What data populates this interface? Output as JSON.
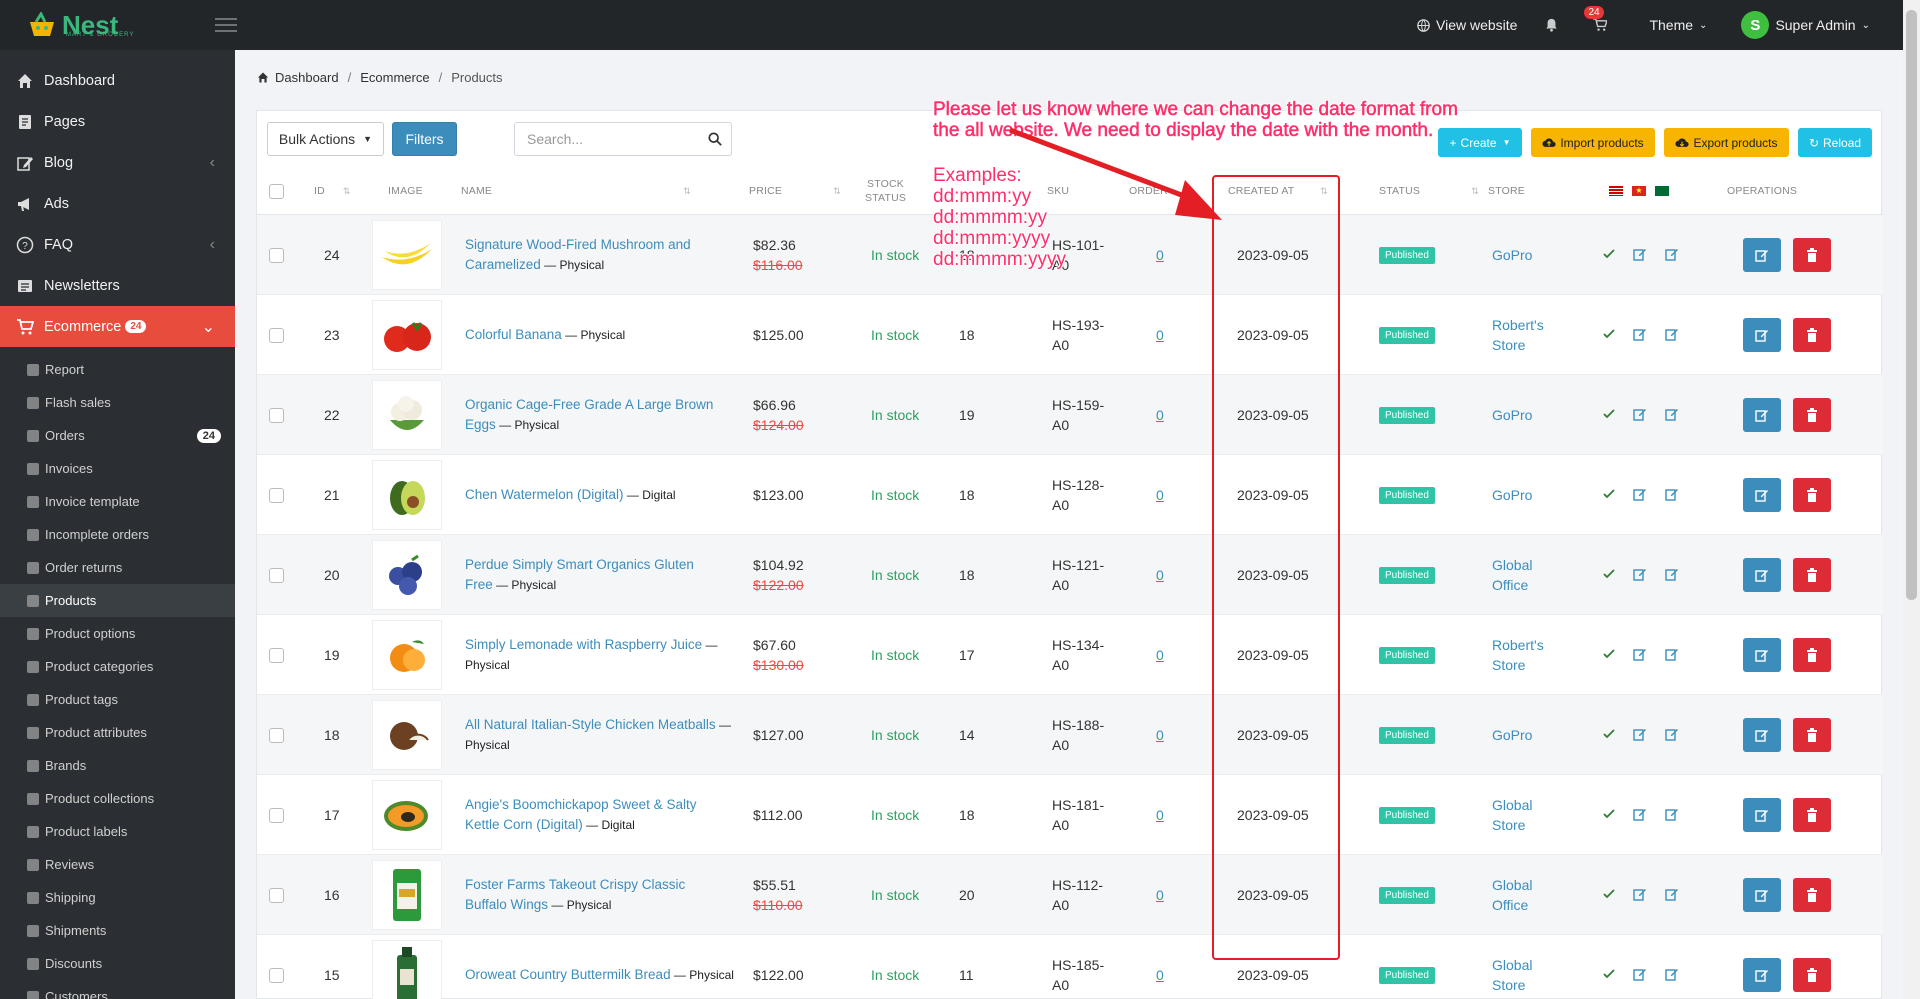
{
  "topbar": {
    "brand": "Nest",
    "brand_sub": "MART & GROCERY",
    "view_website": "View website",
    "notif_count": "24",
    "theme": "Theme",
    "avatar_letter": "S",
    "user": "Super Admin"
  },
  "sidebar": {
    "main": [
      {
        "label": "Dashboard"
      },
      {
        "label": "Pages"
      },
      {
        "label": "Blog"
      },
      {
        "label": "Ads"
      },
      {
        "label": "FAQ"
      },
      {
        "label": "Newsletters"
      }
    ],
    "ecommerce": {
      "label": "Ecommerce",
      "count": "24"
    },
    "sub": [
      {
        "label": "Report"
      },
      {
        "label": "Flash sales"
      },
      {
        "label": "Orders",
        "badge": "24"
      },
      {
        "label": "Invoices"
      },
      {
        "label": "Invoice template"
      },
      {
        "label": "Incomplete orders"
      },
      {
        "label": "Order returns"
      },
      {
        "label": "Products"
      },
      {
        "label": "Product options"
      },
      {
        "label": "Product categories"
      },
      {
        "label": "Product tags"
      },
      {
        "label": "Product attributes"
      },
      {
        "label": "Brands"
      },
      {
        "label": "Product collections"
      },
      {
        "label": "Product labels"
      },
      {
        "label": "Reviews"
      },
      {
        "label": "Shipping"
      },
      {
        "label": "Shipments"
      },
      {
        "label": "Discounts"
      },
      {
        "label": "Customers"
      }
    ]
  },
  "breadcrumb": [
    "Dashboard",
    "Ecommerce",
    "Products"
  ],
  "toolbar": {
    "bulk": "Bulk Actions",
    "filters": "Filters",
    "search_placeholder": "Search...",
    "create": "Create",
    "import": "Import products",
    "export": "Export products",
    "reload": "Reload"
  },
  "columns": {
    "id": "ID",
    "image": "IMAGE",
    "name": "NAME",
    "price": "PRICE",
    "stock_1": "STOCK",
    "stock_2": "STATUS",
    "sku": "SKU",
    "order": "ORDER",
    "created": "CREATED AT",
    "status": "STATUS",
    "store": "STORE",
    "operations": "OPERATIONS"
  },
  "rows": [
    {
      "id": "24",
      "name1": "Signature Wood-Fired Mushroom and",
      "name2": "Caramelized",
      "type": " — Physical",
      "price": "$82.36",
      "old": "$116.00",
      "stock": "In stock",
      "qty": "18",
      "sku1": "HS-101-",
      "sku2": "A0",
      "order": "0",
      "created": "2023-09-05",
      "status": "Published",
      "store1": "GoPro",
      "store2": "",
      "img": "banana"
    },
    {
      "id": "23",
      "name1": "Colorful Banana",
      "name2": "",
      "type": " — Physical",
      "price": "$125.00",
      "old": "",
      "stock": "In stock",
      "qty": "18",
      "sku1": "HS-193-",
      "sku2": "A0",
      "order": "0",
      "created": "2023-09-05",
      "status": "Published",
      "store1": "Robert's",
      "store2": "Store",
      "img": "tomato"
    },
    {
      "id": "22",
      "name1": "Organic Cage-Free Grade A Large Brown",
      "name2": "Eggs",
      "type": " — Physical",
      "price": "$66.96",
      "old": "$124.00",
      "stock": "In stock",
      "qty": "19",
      "sku1": "HS-159-",
      "sku2": "A0",
      "order": "0",
      "created": "2023-09-05",
      "status": "Published",
      "store1": "GoPro",
      "store2": "",
      "img": "cauliflower"
    },
    {
      "id": "21",
      "name1": "Chen Watermelon (Digital)",
      "name2": "",
      "type": " — Digital",
      "price": "$123.00",
      "old": "",
      "stock": "In stock",
      "qty": "18",
      "sku1": "HS-128-",
      "sku2": "A0",
      "order": "0",
      "created": "2023-09-05",
      "status": "Published",
      "store1": "GoPro",
      "store2": "",
      "img": "avocado"
    },
    {
      "id": "20",
      "name1": "Perdue Simply Smart Organics Gluten",
      "name2": "Free",
      "type": " — Physical",
      "price": "$104.92",
      "old": "$122.00",
      "stock": "In stock",
      "qty": "18",
      "sku1": "HS-121-",
      "sku2": "A0",
      "order": "0",
      "created": "2023-09-05",
      "status": "Published",
      "store1": "Global",
      "store2": "Office",
      "img": "blueberry"
    },
    {
      "id": "19",
      "name1": "Simply Lemonade with Raspberry Juice",
      "name2": "",
      "type": " — Physical",
      "price": "$67.60",
      "old": "$130.00",
      "stock": "In stock",
      "qty": "17",
      "sku1": "HS-134-",
      "sku2": "A0",
      "order": "0",
      "created": "2023-09-05",
      "status": "Published",
      "store1": "Robert's",
      "store2": "Store",
      "img": "orange"
    },
    {
      "id": "18",
      "name1": "All Natural Italian-Style Chicken Meatballs",
      "name2": "",
      "type": " — Physical",
      "price": "$127.00",
      "old": "",
      "stock": "In stock",
      "qty": "14",
      "sku1": "HS-188-",
      "sku2": "A0",
      "order": "0",
      "created": "2023-09-05",
      "status": "Published",
      "store1": "GoPro",
      "store2": "",
      "img": "coconut"
    },
    {
      "id": "17",
      "name1": "Angie's Boomchickapop Sweet & Salty",
      "name2": "Kettle Corn (Digital)",
      "type": " — Digital",
      "price": "$112.00",
      "old": "",
      "stock": "In stock",
      "qty": "18",
      "sku1": "HS-181-",
      "sku2": "A0",
      "order": "0",
      "created": "2023-09-05",
      "status": "Published",
      "store1": "Global",
      "store2": "Store",
      "img": "papaya"
    },
    {
      "id": "16",
      "name1": "Foster Farms Takeout Crispy Classic",
      "name2": "Buffalo Wings",
      "type": " — Physical",
      "price": "$55.51",
      "old": "$110.00",
      "stock": "In stock",
      "qty": "20",
      "sku1": "HS-112-",
      "sku2": "A0",
      "order": "0",
      "created": "2023-09-05",
      "status": "Published",
      "store1": "Global",
      "store2": "Office",
      "img": "bag"
    },
    {
      "id": "15",
      "name1": "Oroweat Country Buttermilk Bread",
      "name2": "",
      "type": " — Physical",
      "price": "$122.00",
      "old": "",
      "stock": "In stock",
      "qty": "11",
      "sku1": "HS-185-",
      "sku2": "A0",
      "order": "0",
      "created": "2023-09-05",
      "status": "Published",
      "store1": "Global",
      "store2": "Store",
      "img": "bottle"
    }
  ],
  "annotation": {
    "line1": "Please let us know where we can change the date format from",
    "line2": "the all website. We need to display the date with the month.",
    "examples_title": "Examples:",
    "examples": [
      "dd:mmm:yy",
      "dd:mmmm:yy",
      "dd:mmm:yyyy",
      "dd:mmmm:yyyy"
    ]
  },
  "colors": {
    "accent_red": "#e74c3c",
    "brand_green": "#3bb77e",
    "link_blue": "#3c8dbc",
    "annotation": "#ff2f6b"
  }
}
